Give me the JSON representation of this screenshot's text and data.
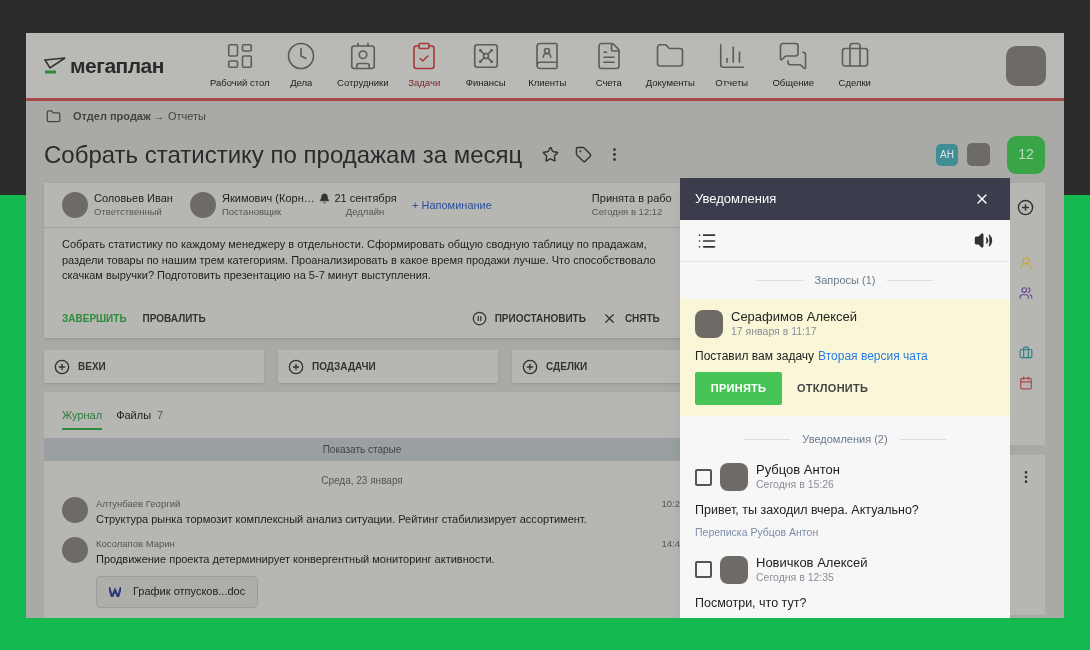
{
  "header": {
    "logo": "мегаплан",
    "nav": [
      {
        "label": "Рабочий стол",
        "selected": false
      },
      {
        "label": "Дела",
        "selected": false
      },
      {
        "label": "Сотрудники",
        "selected": false
      },
      {
        "label": "Задачи",
        "selected": true
      },
      {
        "label": "Финансы",
        "selected": false
      },
      {
        "label": "Клиенты",
        "selected": false
      },
      {
        "label": "Счета",
        "selected": false
      },
      {
        "label": "Документы",
        "selected": false
      },
      {
        "label": "Отчеты",
        "selected": false
      },
      {
        "label": "Общение",
        "selected": false
      },
      {
        "label": "Сделки",
        "selected": false
      }
    ]
  },
  "breadcrumb": "**Отдел продаж** → Отчеты",
  "task": {
    "title": "Собрать статистику по продажам за месяц",
    "watchers": [
      {
        "kind": "initials",
        "text": "АН",
        "color": "#3f8e96"
      },
      {
        "kind": "photo"
      }
    ],
    "counter": "12",
    "people": [
      {
        "name": "Соловьев Иван",
        "role": "Ответственный"
      },
      {
        "name": "Якимович (Корн…",
        "role": "Постановщик"
      }
    ],
    "deadline": {
      "date": "21 сентября",
      "label": "Дедлайн"
    },
    "reminder": "+ Напоминание",
    "status": {
      "text": "Принята в рабо",
      "time": "Сегодня в 12:12"
    },
    "description": "Собрать статистику по каждому менеджеру в отдельности. Сформировать общую сводную таблицу по прадажам, раздели товары по нашим трем категориям. Проанализировать в какое время продажи лучше. Что способствовало скачкам выручки? Подготовить презентацию на 5-7 минут выступления.",
    "actions": [
      {
        "label": "ЗАВЕРШИТЬ",
        "kind": "primary"
      },
      {
        "label": "ПРОВАЛИТЬ",
        "kind": "plain"
      },
      {
        "label": "ПРИОСТАНОВИТЬ",
        "kind": "pause"
      },
      {
        "label": "СНЯТЬ",
        "kind": "cancel"
      }
    ]
  },
  "sections": [
    "ВЕХИ",
    "ПОДЗАДАЧИ",
    "СДЕЛКИ"
  ],
  "journal": {
    "tabs": [
      {
        "label": "Журнал",
        "selected": true
      },
      {
        "label": "Файлы",
        "count": "7",
        "selected": false
      }
    ],
    "show_older": "Показать старые",
    "date": "Среда, 23 января",
    "entries": [
      {
        "author": "Алтунбаев Георгий",
        "text": "Структура рынка тормозит комплексный анализ ситуации. Рейтинг стабилизирует ассортимент.",
        "time": "10:2"
      },
      {
        "author": "Косолапов Марин",
        "text": "Продвижение проекта детерминирует конвергентный мониторинг активности.",
        "time": "14:4",
        "attachment": "График отпусков...doc"
      }
    ]
  },
  "notifications": {
    "title": "Уведомления",
    "requests_header": "Запросы (1)",
    "request": {
      "name": "Серафимов Алексей",
      "time": "17 января в 11:17",
      "text": "Поставил вам задачу",
      "link": "Вторая версия чата",
      "accept": "ПРИНЯТЬ",
      "decline": "ОТКЛОНИТЬ"
    },
    "notifications_header": "Уведомления (2)",
    "items": [
      {
        "name": "Рубцов Антон",
        "time": "Сегодня в 15:26",
        "text": "Привет, ты заходил вчера. Актуально?",
        "source": "Переписка Рубцов Антон",
        "checked": false
      },
      {
        "name": "Новичков Алексей",
        "time": "Сегодня в 12:35",
        "text": "Посмотри, что тут?",
        "checked": false
      }
    ]
  }
}
